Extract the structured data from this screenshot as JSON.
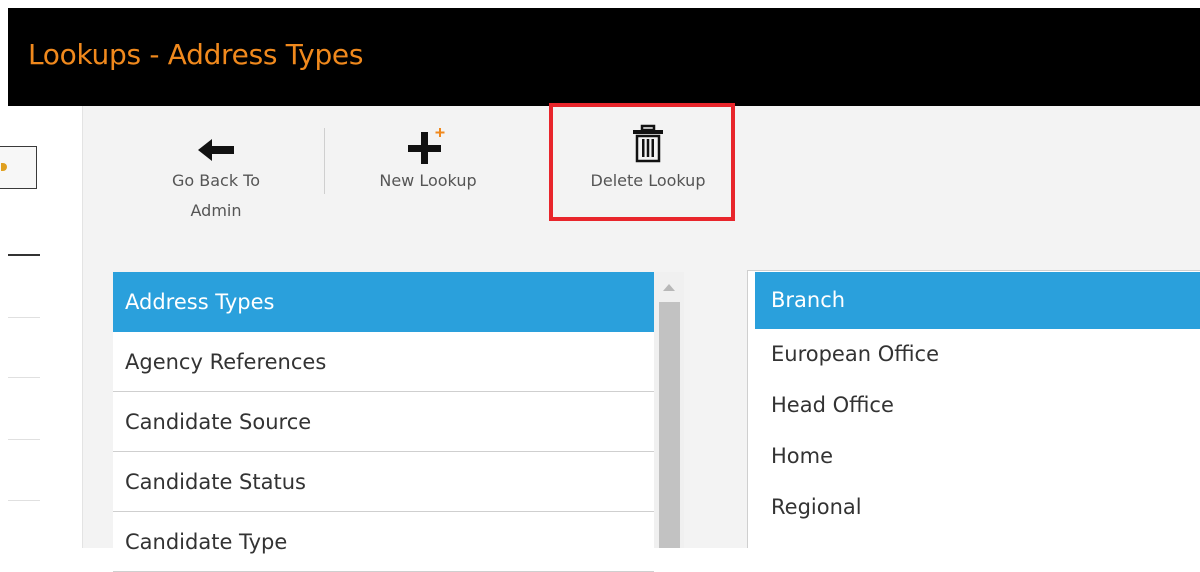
{
  "header": {
    "title": "Lookups - Address Types"
  },
  "toolbar": {
    "back_label_line1": "Go Back To",
    "back_label_line2": "Admin",
    "new_label": "New Lookup",
    "delete_label": "Delete Lookup"
  },
  "lookup_list": {
    "items": [
      {
        "label": "Address Types",
        "selected": true
      },
      {
        "label": "Agency References"
      },
      {
        "label": "Candidate Source"
      },
      {
        "label": "Candidate Status"
      },
      {
        "label": "Candidate Type"
      }
    ]
  },
  "value_list": {
    "items": [
      {
        "label": "Branch",
        "selected": true
      },
      {
        "label": "European Office"
      },
      {
        "label": "Head Office"
      },
      {
        "label": "Home"
      },
      {
        "label": "Regional"
      }
    ]
  },
  "colors": {
    "title": "#f0891d",
    "selection": "#2aa0dc",
    "highlight": "#e8252b"
  },
  "icons": {
    "back": "arrow-left-icon",
    "new": "plus-icon",
    "delete": "trash-icon"
  }
}
